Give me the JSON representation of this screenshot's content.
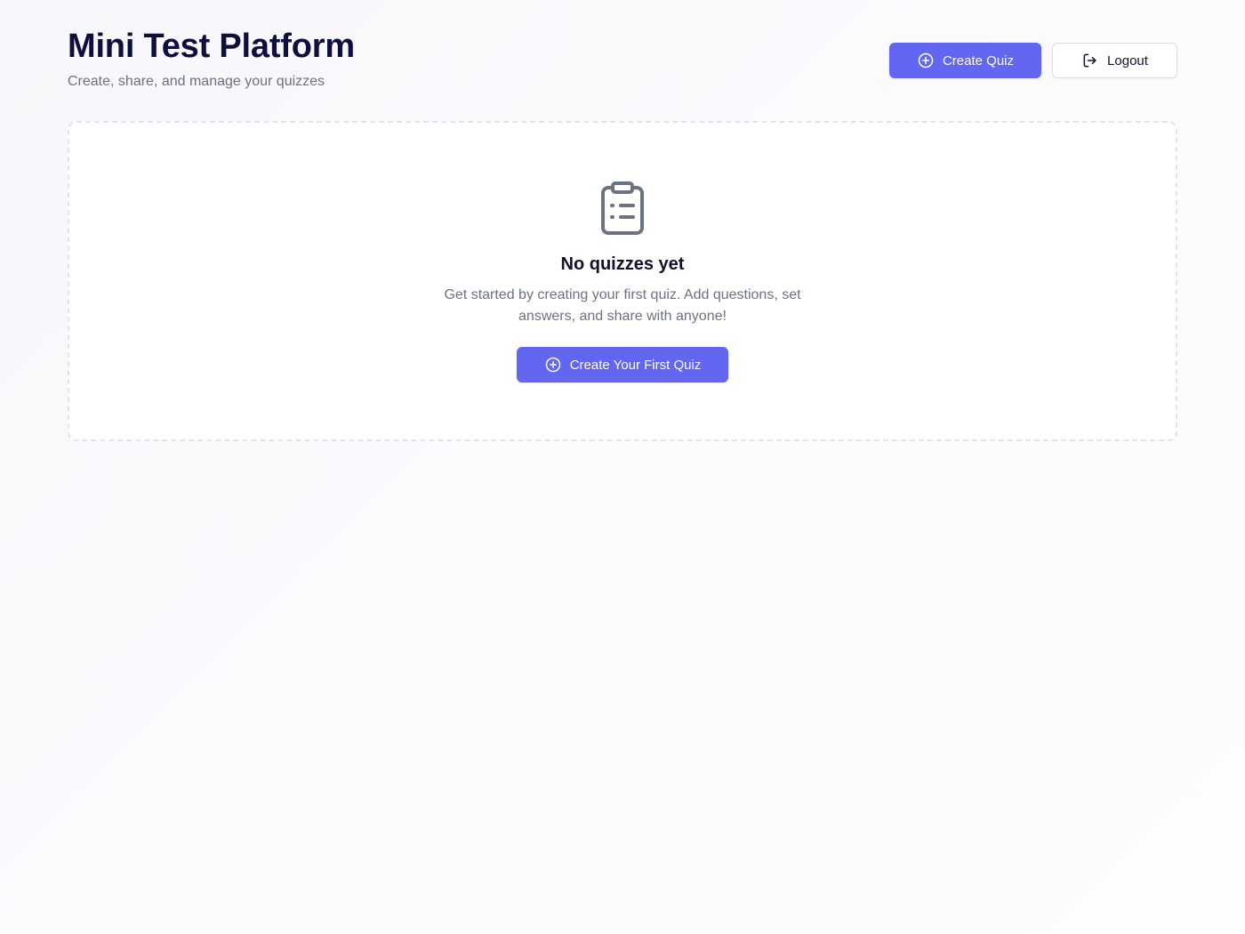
{
  "header": {
    "title": "Mini Test Platform",
    "subtitle": "Create, share, and manage your quizzes"
  },
  "actions": {
    "create_label": "Create Quiz",
    "create_icon": "plus-circle-icon",
    "logout_label": "Logout",
    "logout_icon": "logout-icon"
  },
  "empty_state": {
    "icon": "clipboard-list-icon",
    "title": "No quizzes yet",
    "description": "Get started by creating your first quiz. Add questions, set answers, and share with anyone!",
    "button_label": "Create Your First Quiz",
    "button_icon": "plus-circle-icon"
  },
  "colors": {
    "primary": "#6366f1",
    "title": "#0f0f3d",
    "muted_text": "#6b7280",
    "icon_gray": "#6b7280",
    "border": "#e3e4e9"
  }
}
